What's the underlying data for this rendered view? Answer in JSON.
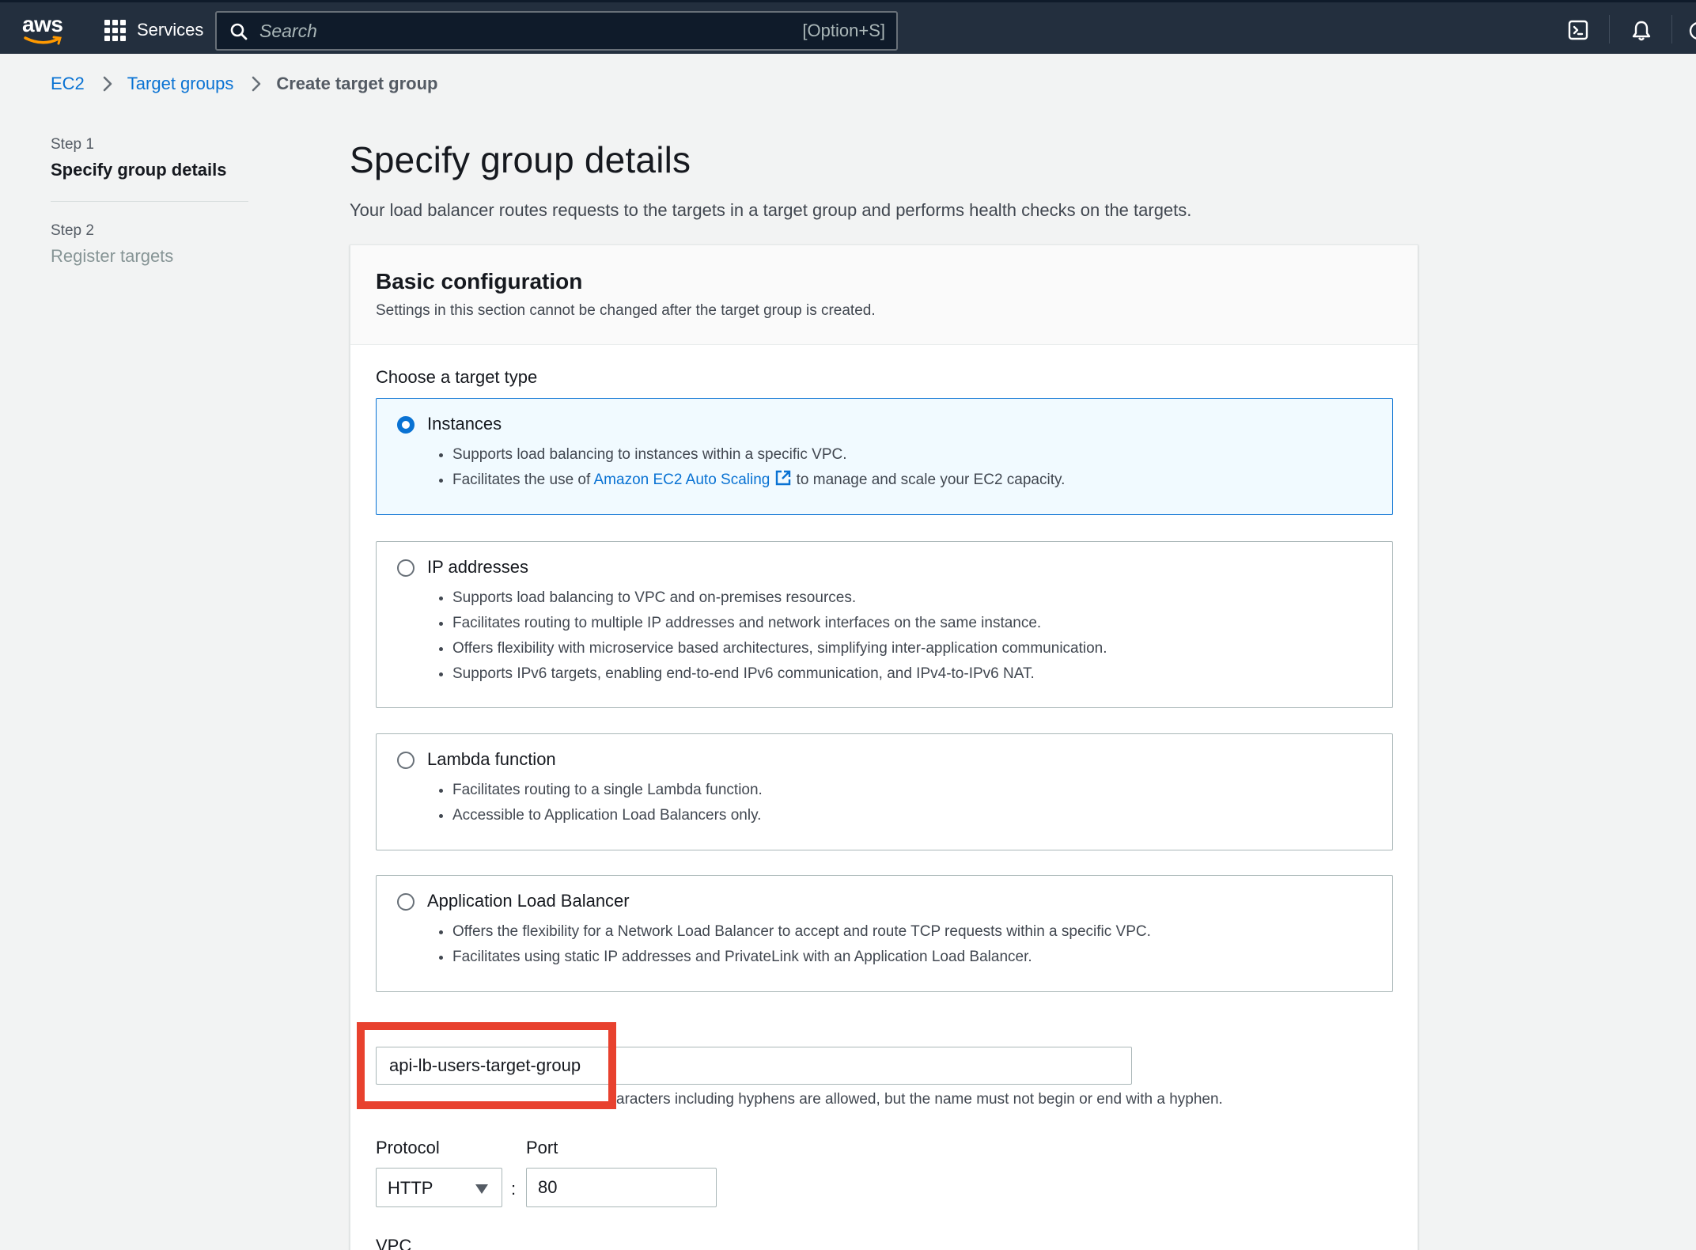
{
  "topnav": {
    "logo_text": "aws",
    "services_label": "Services",
    "search_placeholder": "Search",
    "search_shortcut": "[Option+S]"
  },
  "breadcrumb": {
    "items": [
      "EC2",
      "Target groups"
    ],
    "current": "Create target group"
  },
  "steps": [
    {
      "number": "Step 1",
      "title": "Specify group details"
    },
    {
      "number": "Step 2",
      "title": "Register targets"
    }
  ],
  "page": {
    "title": "Specify group details",
    "description": "Your load balancer routes requests to the targets in a target group and performs health checks on the targets."
  },
  "basic_config": {
    "title": "Basic configuration",
    "subtitle": "Settings in this section cannot be changed after the target group is created.",
    "target_type_label": "Choose a target type",
    "options": [
      {
        "title": "Instances",
        "selected": true,
        "bullets": [
          "Supports load balancing to instances within a specific VPC."
        ],
        "bullet2_prefix": "Facilitates the use of ",
        "bullet2_link": "Amazon EC2 Auto Scaling",
        "bullet2_suffix": " to manage and scale your EC2 capacity."
      },
      {
        "title": "IP addresses",
        "selected": false,
        "bullets": [
          "Supports load balancing to VPC and on-premises resources.",
          "Facilitates routing to multiple IP addresses and network interfaces on the same instance.",
          "Offers flexibility with microservice based architectures, simplifying inter-application communication.",
          "Supports IPv6 targets, enabling end-to-end IPv6 communication, and IPv4-to-IPv6 NAT."
        ]
      },
      {
        "title": "Lambda function",
        "selected": false,
        "bullets": [
          "Facilitates routing to a single Lambda function.",
          "Accessible to Application Load Balancers only."
        ]
      },
      {
        "title": "Application Load Balancer",
        "selected": false,
        "bullets": [
          "Offers the flexibility for a Network Load Balancer to accept and route TCP requests within a specific VPC.",
          "Facilitates using static IP addresses and PrivateLink with an Application Load Balancer."
        ]
      }
    ],
    "name_value": "api-lb-users-target-group",
    "name_hint_visible": "aracters including hyphens are allowed, but the name must not begin or end with a hyphen.",
    "protocol_label": "Protocol",
    "protocol_value": "HTTP",
    "port_label": "Port",
    "port_value": "80",
    "vpc_label": "VPC"
  },
  "colors": {
    "nav_bg": "#232f3e",
    "link": "#0972d3",
    "highlight": "#e8412e"
  }
}
